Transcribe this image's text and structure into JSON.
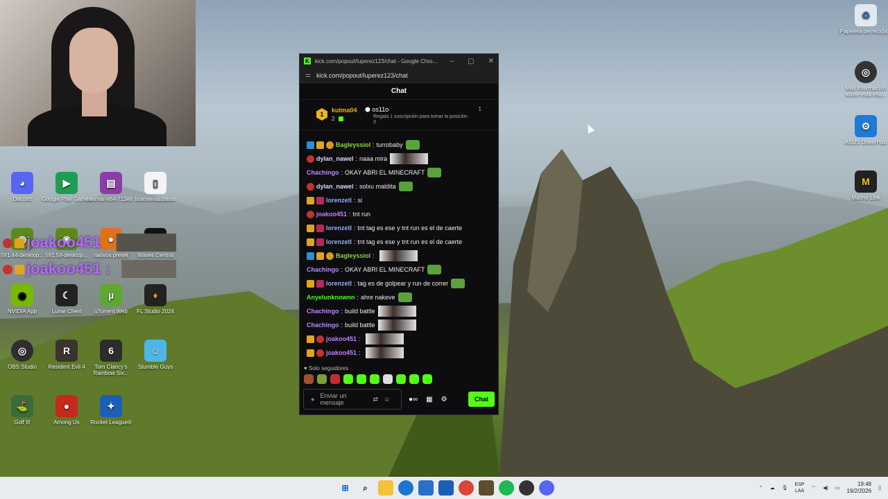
{
  "window": {
    "title": "kick.com/popout/luperez123/chat - Google Chro...",
    "url": "kick.com/popout/luperez123/chat",
    "header": "Chat"
  },
  "pinned": {
    "gifter_name": "kutma04",
    "gifter_count": "2",
    "subscriber_name": "os11o",
    "subscriber_message": "Regala 1 suscripción para tomar la posición 3",
    "right_count": "1"
  },
  "messages": [
    {
      "user": "Bagleyssiol",
      "color": "#8ad24a",
      "badges": [
        "w",
        "c",
        "o"
      ],
      "text": "turrobaby",
      "emote": "em"
    },
    {
      "user": "dylan_nawel",
      "color": "#d7d7ff",
      "badges": [
        "s"
      ],
      "text": "naaa mira",
      "emote": "img"
    },
    {
      "user": "Chachingo",
      "color": "#b98bff",
      "badges": [],
      "text": "OKAY ABRI EL MINECRAFT",
      "emote": "em"
    },
    {
      "user": "dylan_nawel",
      "color": "#d7d7ff",
      "badges": [
        "s"
      ],
      "text": "solxu maldita",
      "emote": "em"
    },
    {
      "user": "lorenzetl",
      "color": "#8fb0ff",
      "badges": [
        "c",
        "r"
      ],
      "text": "si",
      "emote": ""
    },
    {
      "user": "joakoo451",
      "color": "#c77dff",
      "badges": [
        "s"
      ],
      "text": "tnt run",
      "emote": ""
    },
    {
      "user": "lorenzetl",
      "color": "#8fb0ff",
      "badges": [
        "c",
        "r"
      ],
      "text": "tnt tag es ese y tnt run es el de caerte",
      "emote": ""
    },
    {
      "user": "lorenzetl",
      "color": "#8fb0ff",
      "badges": [
        "c",
        "r"
      ],
      "text": "tnt tag es ese y tnt run es el de caerte",
      "emote": ""
    },
    {
      "user": "Bagleyssiol",
      "color": "#8ad24a",
      "badges": [
        "w",
        "c",
        "o"
      ],
      "text": "",
      "emote": "img"
    },
    {
      "user": "Chachingo",
      "color": "#b98bff",
      "badges": [],
      "text": "OKAY ABRI EL MINECRAFT",
      "emote": "em"
    },
    {
      "user": "lorenzetl",
      "color": "#8fb0ff",
      "badges": [
        "c",
        "r"
      ],
      "text": "tag es de golpear y run de correr",
      "emote": "em"
    },
    {
      "user": "Anyelunknownn",
      "color": "#53fc18",
      "badges": [],
      "text": "ahre nakeve",
      "emote": "em"
    },
    {
      "user": "Chachingo",
      "color": "#b98bff",
      "badges": [],
      "text": "build battle",
      "emote": "img"
    },
    {
      "user": "Chachingo",
      "color": "#b98bff",
      "badges": [],
      "text": "build battle",
      "emote": "img"
    },
    {
      "user": "joakoo451",
      "color": "#c77dff",
      "badges": [
        "c",
        "s"
      ],
      "text": "",
      "emote": "img"
    },
    {
      "user": "joakoo451",
      "color": "#c77dff",
      "badges": [
        "c",
        "s"
      ],
      "text": "",
      "emote": "img"
    }
  ],
  "footer": {
    "followers_only": "Solo seguidores",
    "input_placeholder": "Enviar un mensaje",
    "chat_button": "Chat"
  },
  "desktop_icons": [
    {
      "label": "Papelera de reciclaje"
    },
    {
      "label": "Más información sobre esta ima..."
    },
    {
      "label": "ASUS DriverHub"
    },
    {
      "label": "Maono Link"
    },
    {
      "label": "Discord"
    },
    {
      "label": "Google Play Games"
    },
    {
      "label": "winrar-x64-713es"
    },
    {
      "label": "licensevalidation"
    },
    {
      "label": "591.44-desktop..."
    },
    {
      "label": "591.59-desktop..."
    },
    {
      "label": "nativos preset"
    },
    {
      "label": "Waves Central"
    },
    {
      "label": "NVIDIA App"
    },
    {
      "label": "Lunar Client"
    },
    {
      "label": "uTorrent Web"
    },
    {
      "label": "FL Studio 2024"
    },
    {
      "label": "OBS Studio"
    },
    {
      "label": "Resident Evil 4"
    },
    {
      "label": "Tom Clancy's Rainbow Six..."
    },
    {
      "label": "Stumble Guys"
    },
    {
      "label": "Golf It!"
    },
    {
      "label": "Among Us"
    },
    {
      "label": "Rocket League®"
    }
  ],
  "overlay": {
    "line1": "joakoo451",
    "line2": "joakoo451 :"
  },
  "tray": {
    "lang1": "ESP",
    "lang2": "LAA",
    "time": "19:48",
    "date": "19/2/2026"
  }
}
